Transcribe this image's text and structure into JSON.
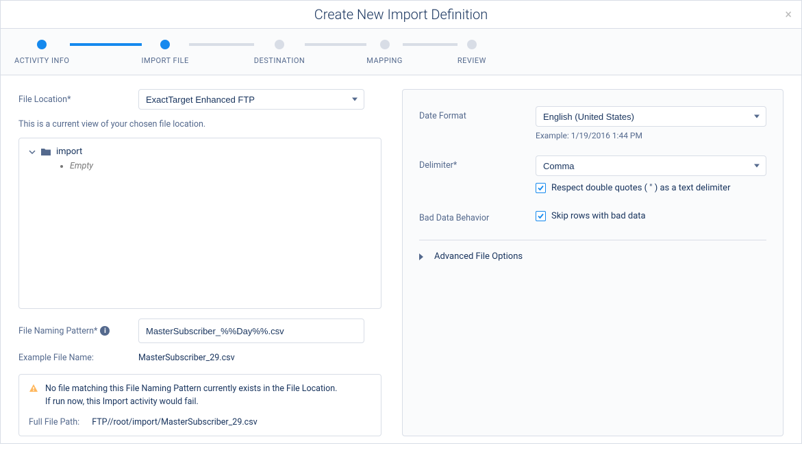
{
  "header": {
    "title": "Create New Import Definition"
  },
  "stepper": {
    "steps": [
      {
        "label": "ACTIVITY INFO",
        "active": true
      },
      {
        "label": "IMPORT FILE",
        "active": true
      },
      {
        "label": "DESTINATION",
        "active": false
      },
      {
        "label": "MAPPING",
        "active": false
      },
      {
        "label": "REVIEW",
        "active": false
      }
    ]
  },
  "left": {
    "file_location_label": "File Location*",
    "file_location_value": "ExactTarget Enhanced FTP",
    "hint": "This is a current view of your chosen file location.",
    "tree_root": "import",
    "tree_empty": "Empty",
    "file_naming_label": "File Naming Pattern*",
    "file_naming_value": "MasterSubscriber_%%Day%%.csv",
    "example_label": "Example File Name:",
    "example_value": "MasterSubscriber_29.csv",
    "warning_line1": "No file matching this File Naming Pattern currently exists in the File Location.",
    "warning_line2": "If run now, this Import activity would fail.",
    "full_path_label": "Full File Path:",
    "full_path_value": "FTP//root/import/MasterSubscriber_29.csv"
  },
  "right": {
    "date_format_label": "Date Format",
    "date_format_value": "English (United States)",
    "date_format_example": "Example: 1/19/2016 1:44 PM",
    "delimiter_label": "Delimiter*",
    "delimiter_value": "Comma",
    "respect_quotes": "Respect double quotes ( \" ) as a text delimiter",
    "bad_data_label": "Bad Data Behavior",
    "skip_rows": "Skip rows with bad data",
    "advanced_label": "Advanced File Options"
  }
}
